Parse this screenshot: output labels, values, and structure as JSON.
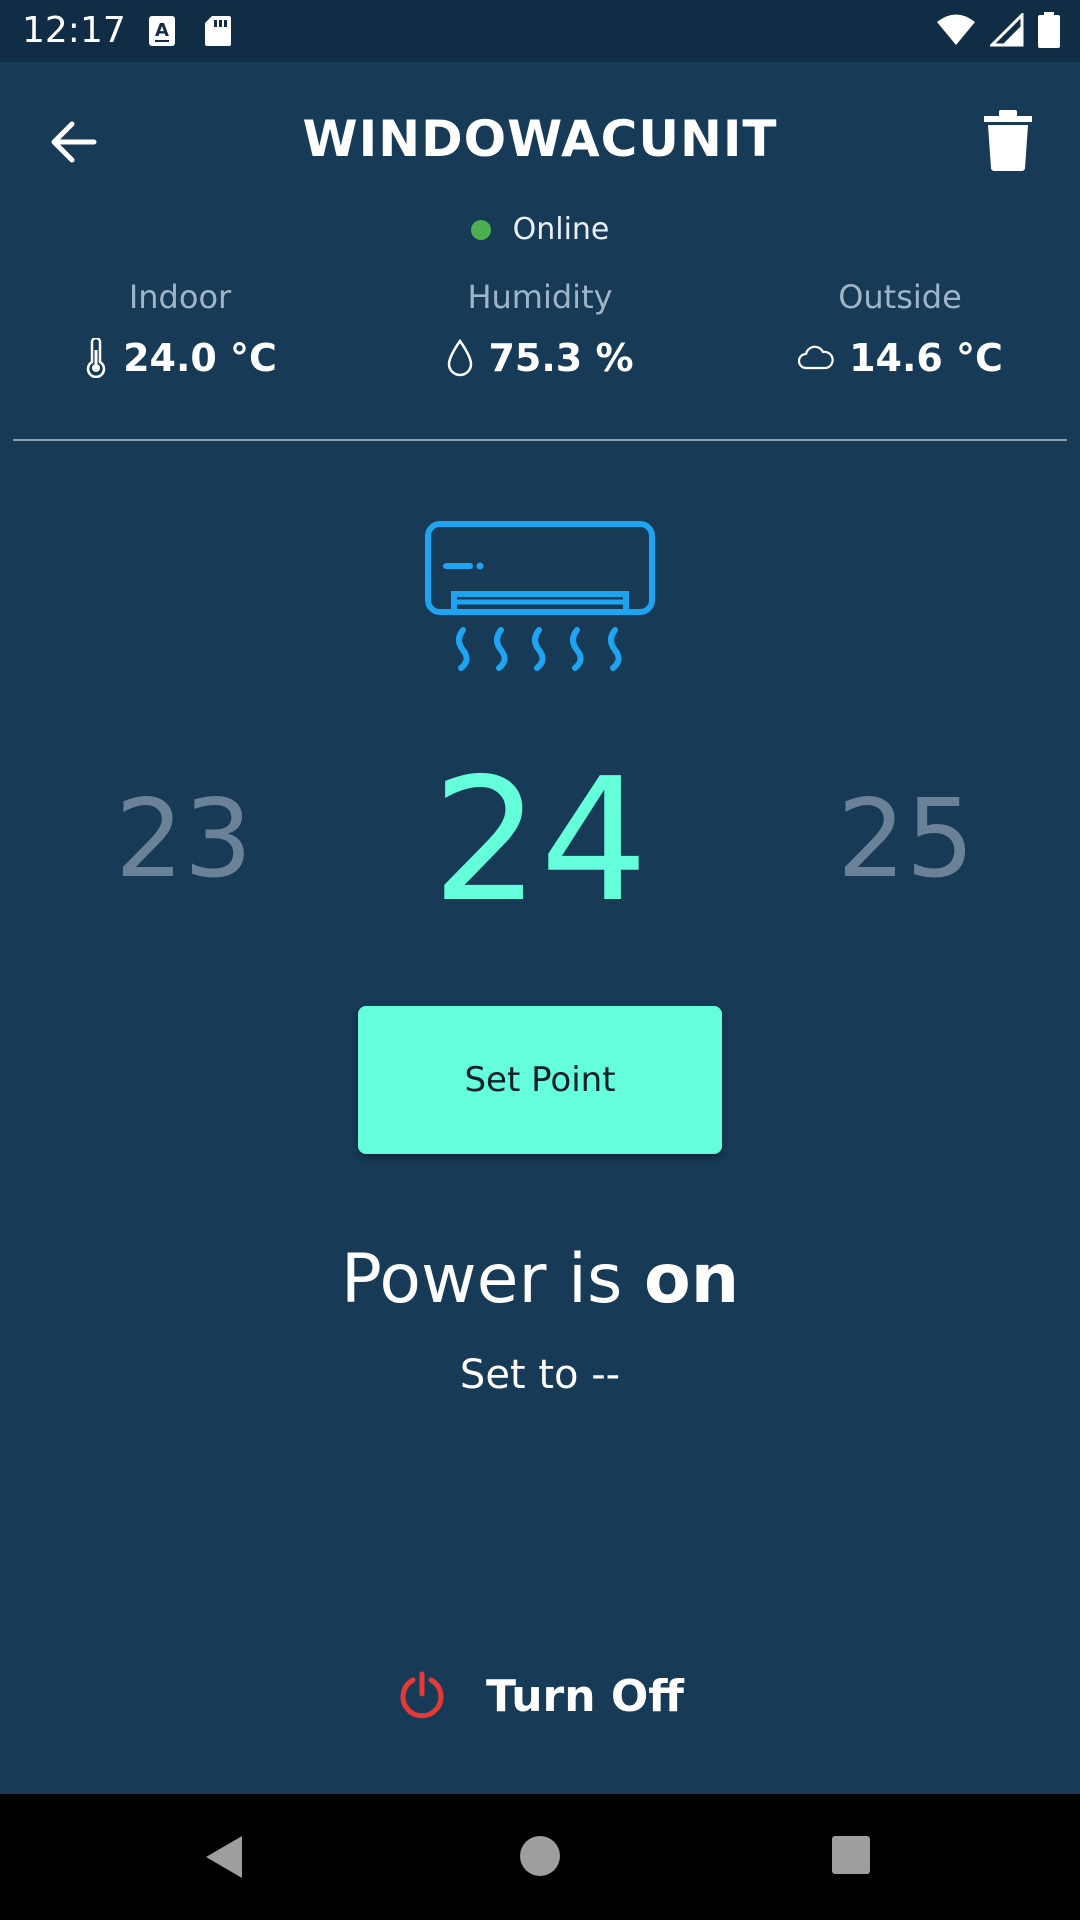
{
  "status_bar": {
    "time": "12:17"
  },
  "header": {
    "title": "WINDOWACUNIT"
  },
  "connection": {
    "status": "Online",
    "color": "#4caf50"
  },
  "stats": {
    "indoor": {
      "label": "Indoor",
      "value": "24.0 °C",
      "icon": "thermometer-icon"
    },
    "humidity": {
      "label": "Humidity",
      "value": "75.3 %",
      "icon": "water-drop-icon"
    },
    "outside": {
      "label": "Outside",
      "value": "14.6 °C",
      "icon": "cloud-icon"
    }
  },
  "device_icon": "air-conditioner-icon",
  "temperature_picker": {
    "previous": "23",
    "current": "24",
    "next": "25"
  },
  "setpoint_button": {
    "label": "Set Point"
  },
  "power": {
    "prefix": "Power is ",
    "state": "on",
    "set_to": "Set to --"
  },
  "turn_off": {
    "label": "Turn Off",
    "icon": "power-icon",
    "icon_color": "#e53935"
  },
  "colors": {
    "background": "#173a56",
    "accent": "#64ffda",
    "ac_icon": "#1ea4f0",
    "muted_text": "#9fb4c7"
  }
}
